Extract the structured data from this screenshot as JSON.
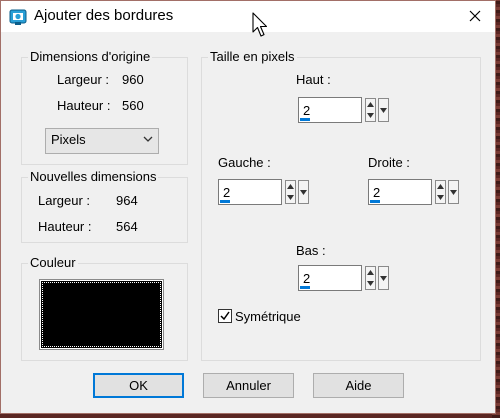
{
  "window": {
    "title": "Ajouter des bordures",
    "icon": "borders-app-icon",
    "close_icon": "close-icon"
  },
  "original_dimensions": {
    "legend": "Dimensions d'origine",
    "width_label": "Largeur :",
    "width_value": "960",
    "height_label": "Hauteur :",
    "height_value": "560",
    "unit_select": "Pixels"
  },
  "new_dimensions": {
    "legend": "Nouvelles dimensions",
    "width_label": "Largeur :",
    "width_value": "964",
    "height_label": "Hauteur :",
    "height_value": "564"
  },
  "color": {
    "legend": "Couleur",
    "swatch": "#000000"
  },
  "pixel_size": {
    "legend": "Taille en pixels",
    "top_label": "Haut :",
    "top_value": "2",
    "left_label": "Gauche :",
    "left_value": "2",
    "right_label": "Droite :",
    "right_value": "2",
    "bottom_label": "Bas :",
    "bottom_value": "2",
    "symmetric_label": "Symétrique",
    "symmetric_checked": true
  },
  "buttons": {
    "ok": "OK",
    "cancel": "Annuler",
    "help": "Aide"
  },
  "colors": {
    "accent": "#0078d7",
    "dialog_bg": "#f0f0f0",
    "desktop_bg": "#5a2622"
  }
}
